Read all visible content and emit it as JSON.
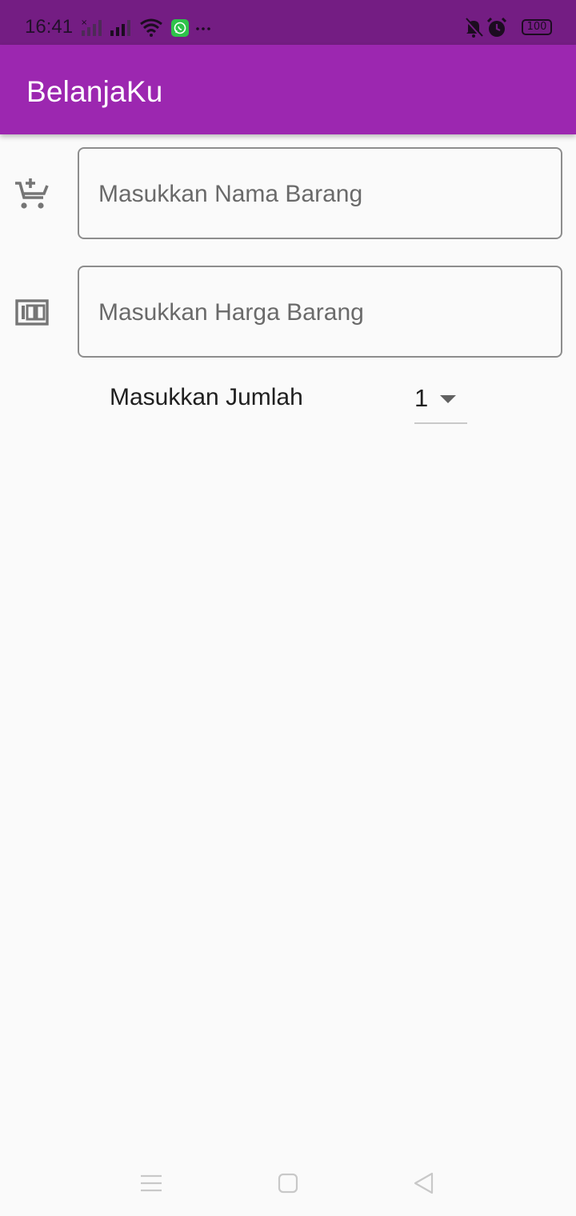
{
  "status_bar": {
    "time": "16:41",
    "battery": "100",
    "icons": [
      "no-signal-icon",
      "signal-icon",
      "wifi-icon",
      "whatsapp-icon",
      "more-dots-icon",
      "mute-icon",
      "alarm-icon",
      "battery-icon"
    ]
  },
  "app_bar": {
    "title": "BelanjaKu",
    "color": "#9c27b0"
  },
  "form": {
    "name_field": {
      "icon": "add-cart-icon",
      "placeholder": "Masukkan Nama Barang",
      "value": ""
    },
    "price_field": {
      "icon": "money-icon",
      "placeholder": "Masukkan Harga Barang",
      "value": ""
    },
    "quantity": {
      "label": "Masukkan Jumlah",
      "selected": "1"
    }
  },
  "nav_bar": {
    "icons": [
      "menu-icon",
      "home-icon",
      "back-icon"
    ]
  }
}
